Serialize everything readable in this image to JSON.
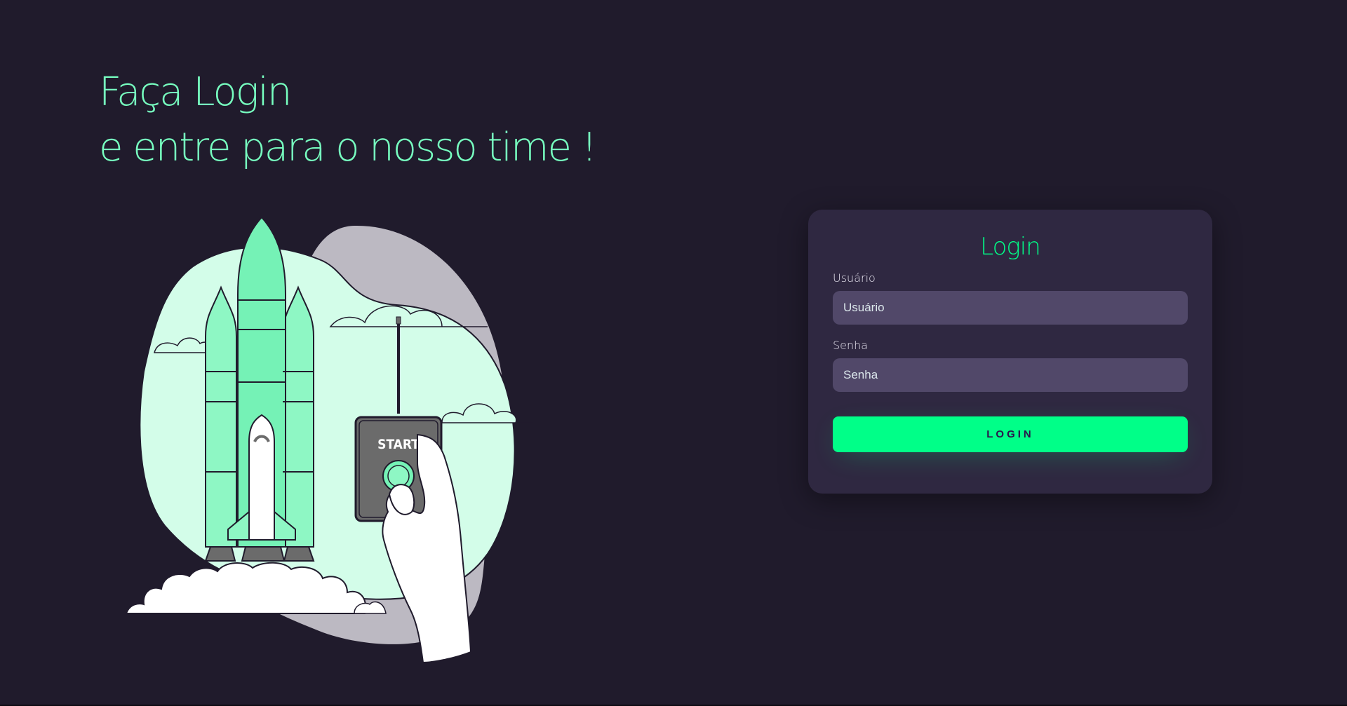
{
  "hero": {
    "headline_line1": "Faça Login",
    "headline_line2": "e entre para o nosso time !",
    "illustration": {
      "icon": "rocket-launch-illustration",
      "button_label": "START"
    }
  },
  "login_form": {
    "title": "Login",
    "username": {
      "label": "Usuário",
      "placeholder": "Usuário",
      "value": ""
    },
    "password": {
      "label": "Senha",
      "placeholder": "Senha",
      "value": ""
    },
    "submit_label": "LOGIN"
  },
  "colors": {
    "background": "#201b2c",
    "card": "#2f2841",
    "input": "#514869",
    "accent": "#00ff88",
    "headline": "#77ffc0"
  }
}
